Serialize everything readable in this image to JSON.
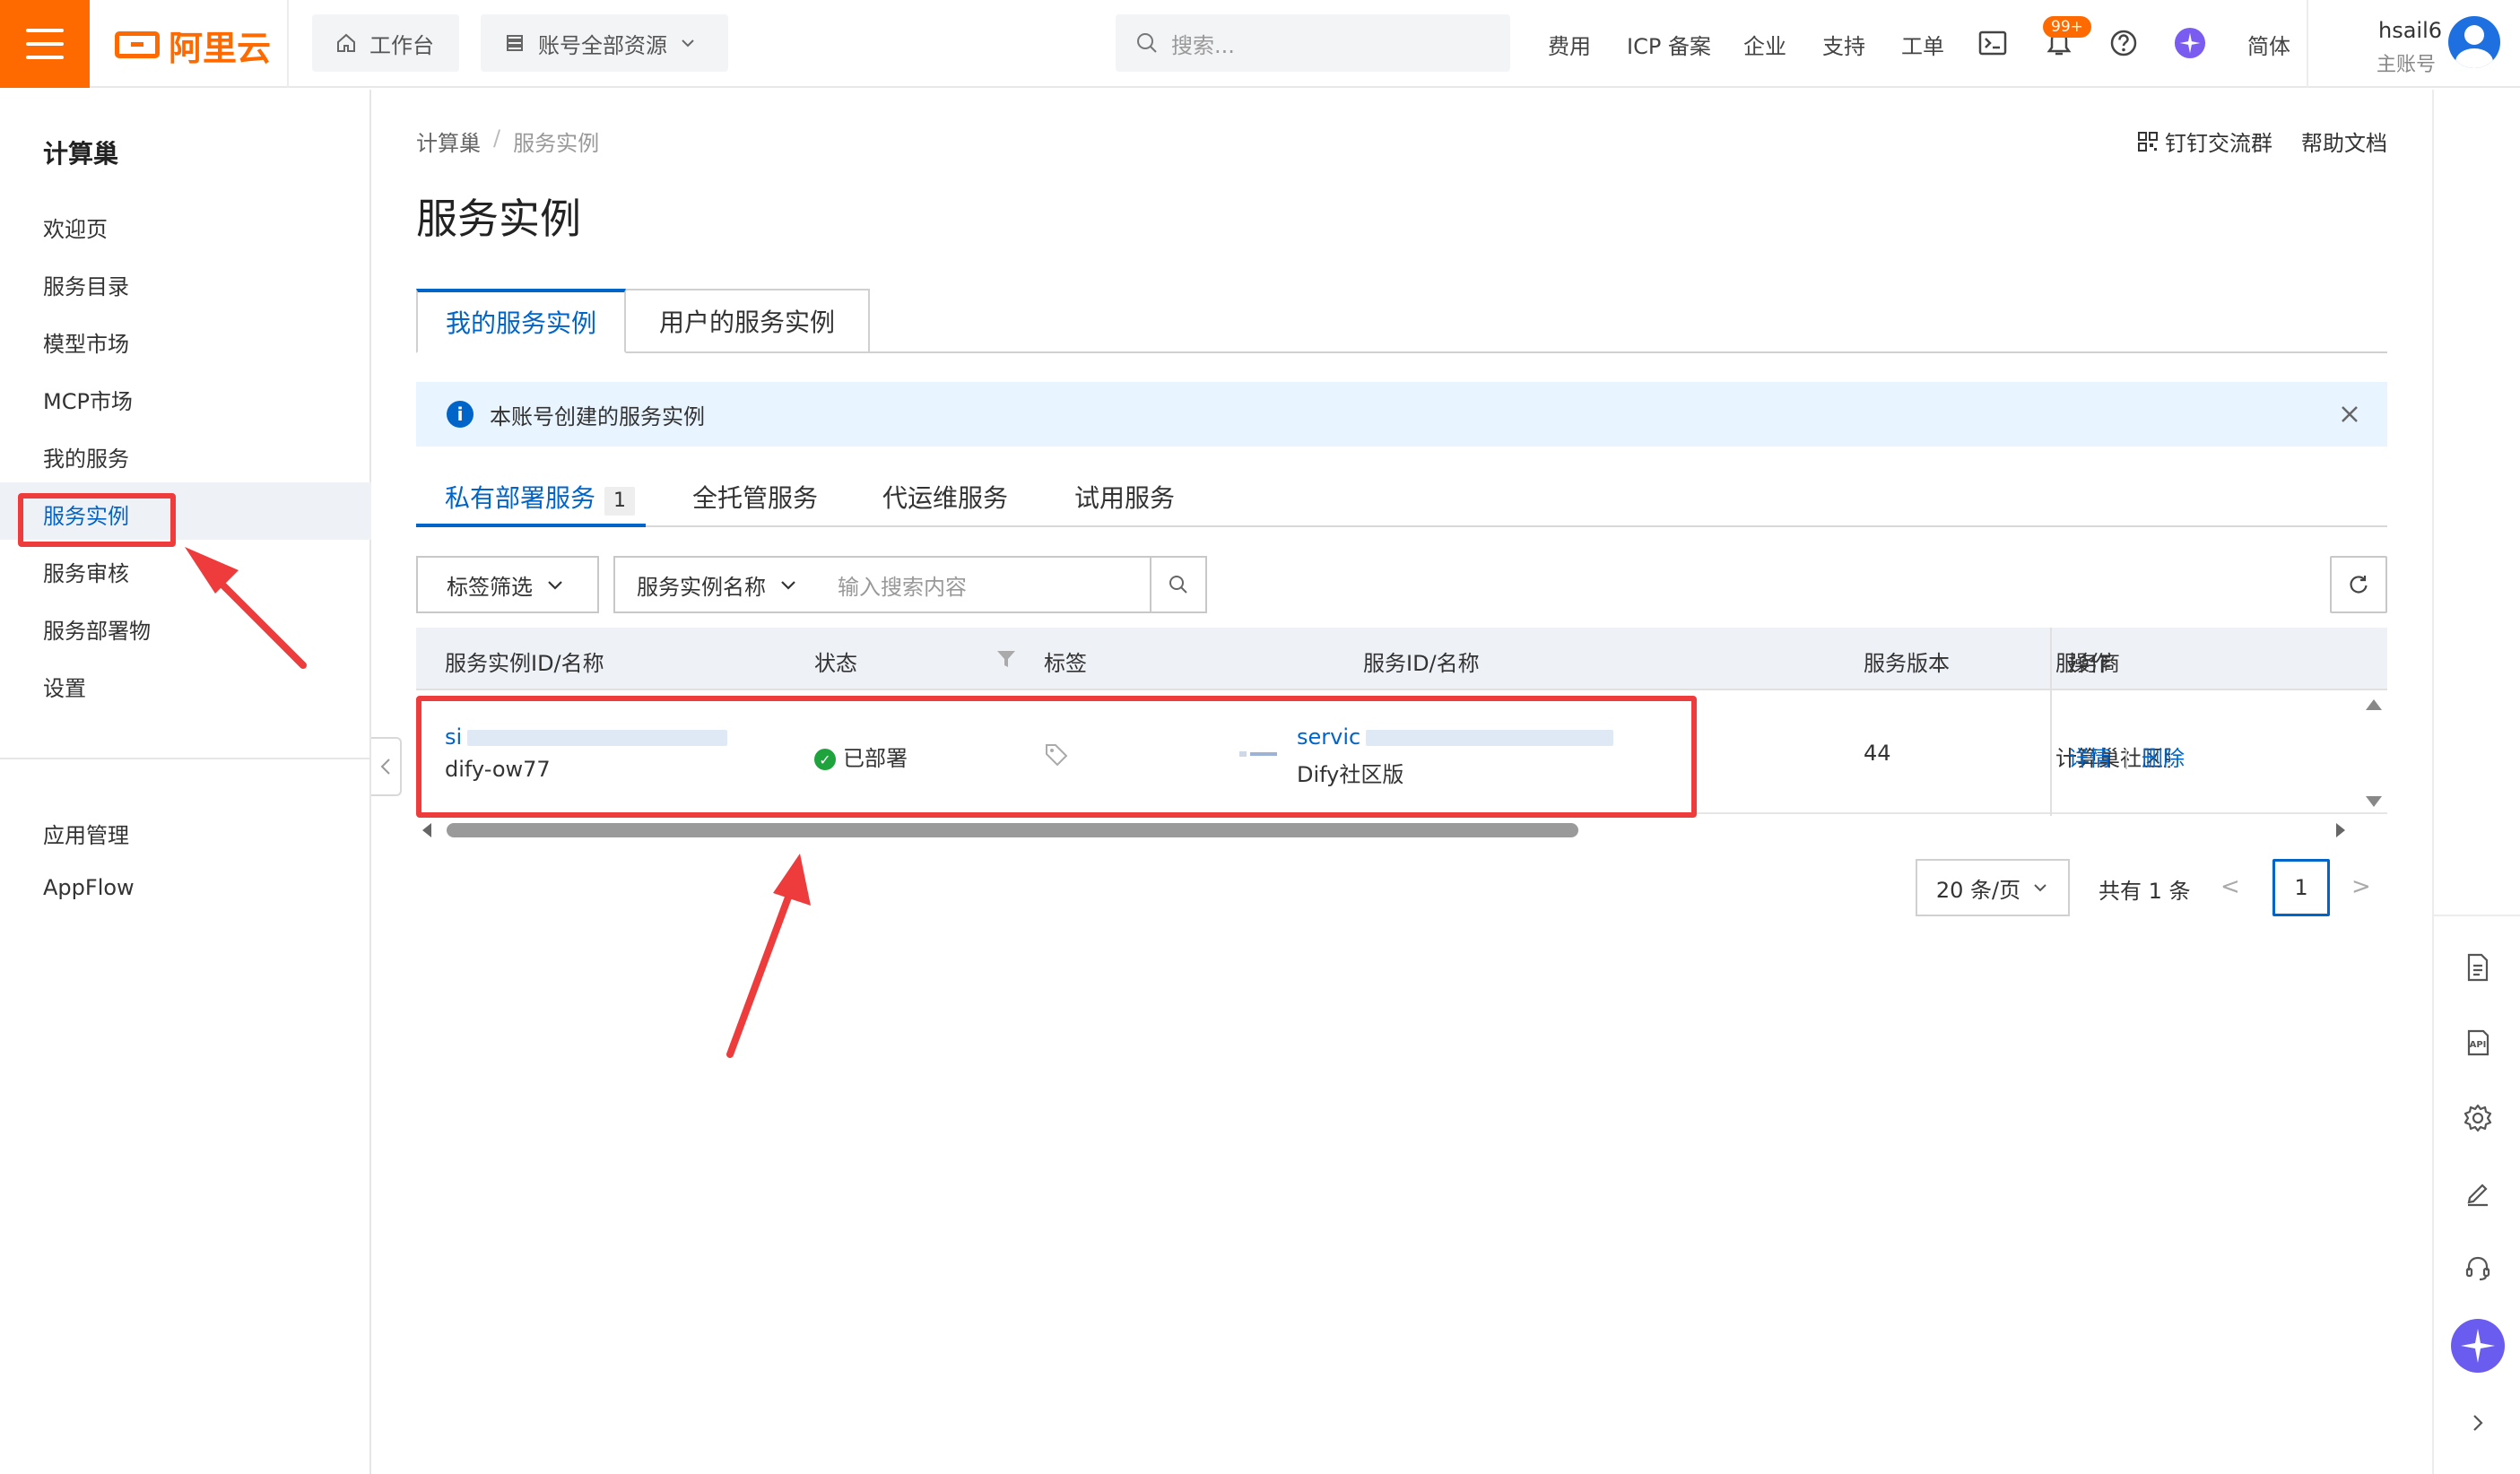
{
  "topbar": {
    "brand": "阿里云",
    "workbench": "工作台",
    "resource_scope": "账号全部资源",
    "search_placeholder": "搜索...",
    "links": [
      "费用",
      "ICP 备案",
      "企业",
      "支持",
      "工单"
    ],
    "notification_badge": "99+",
    "language": "简体",
    "user_name": "hsail6",
    "user_role": "主账号"
  },
  "sidebar": {
    "title": "计算巢",
    "items": [
      "欢迎页",
      "服务目录",
      "模型市场",
      "MCP市场",
      "我的服务",
      "服务实例",
      "服务审核",
      "服务部署物",
      "设置"
    ],
    "active_item": "服务实例",
    "extra_items": [
      "应用管理",
      "AppFlow"
    ]
  },
  "breadcrumb": [
    "计算巢",
    "服务实例"
  ],
  "header_actions": {
    "dingtalk": "钉钉交流群",
    "help": "帮助文档"
  },
  "page_title": "服务实例",
  "tabs": [
    "我的服务实例",
    "用户的服务实例"
  ],
  "info_banner": "本账号创建的服务实例",
  "subtabs": [
    {
      "label": "私有部署服务",
      "count": "1"
    },
    {
      "label": "全托管服务"
    },
    {
      "label": "代运维服务"
    },
    {
      "label": "试用服务"
    }
  ],
  "filters": {
    "tag_filter": "标签筛选",
    "field_select": "服务实例名称",
    "search_placeholder": "输入搜索内容"
  },
  "table": {
    "columns": [
      "服务实例ID/名称",
      "状态",
      "标签",
      "服务ID/名称",
      "服务版本",
      "服务商",
      "操作"
    ],
    "rows": [
      {
        "instance_id": "si",
        "instance_name": "dify-ow77",
        "status": "已部署",
        "service_id": "servic",
        "service_name": "Dify社区版",
        "version": "44",
        "provider": "计算巢社区服",
        "actions": [
          "详情",
          "删除"
        ]
      }
    ]
  },
  "pagination": {
    "page_size": "20 条/页",
    "total": "共有 1 条",
    "current_page": "1"
  },
  "colors": {
    "brand_orange": "#ff6a00",
    "primary_blue": "#0064c8",
    "annotation_red": "#ee3b3b"
  }
}
